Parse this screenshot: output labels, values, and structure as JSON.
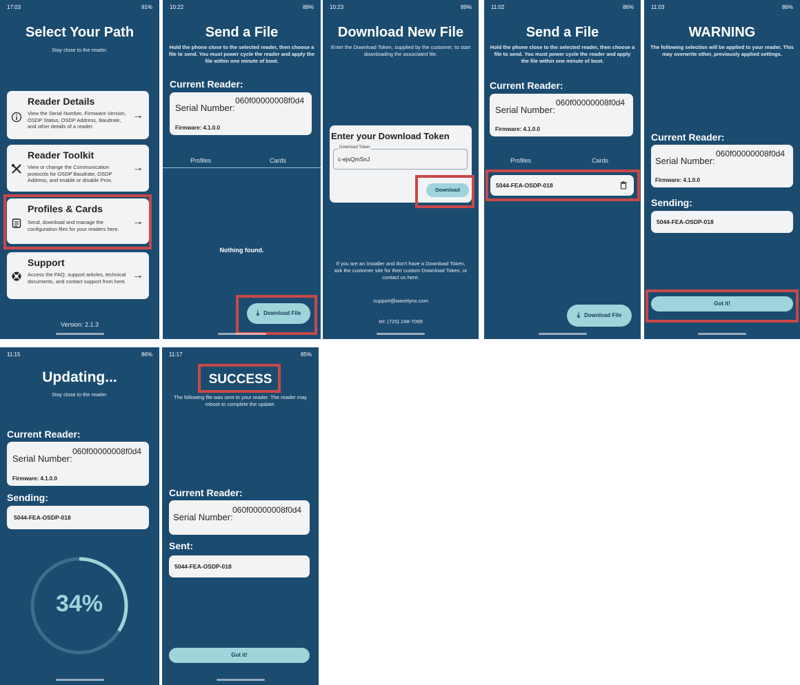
{
  "screens": {
    "s1": {
      "status_time": "17:03",
      "status_right": "91%",
      "title": "Select Your Path",
      "subtitle": "Stay close to the reader.",
      "items": [
        {
          "title": "Reader Details",
          "desc": "View the Serial Number, Firmware Version, OSDP Status, OSDP Address, Baudrate, and other details of a reader.",
          "icon": "info-icon"
        },
        {
          "title": "Reader Toolkit",
          "desc": "View or change the Communication protocols for OSDP Baudrate, OSDP Address, and enable or disable Prox.",
          "icon": "tools-icon"
        },
        {
          "title": "Profiles & Cards",
          "desc": "Send, download and manage the configuration files for your readers here.",
          "icon": "document-icon"
        },
        {
          "title": "Support",
          "desc": "Access the FAQ, support articles, technical documents, and contact support from here.",
          "icon": "lifebuoy-icon"
        }
      ],
      "arrow": "→",
      "version": "Version: 2.1.3"
    },
    "s2": {
      "status_time": "10:22",
      "status_right": "89%",
      "title": "Send a File",
      "subtitle": "Hold the phone close to the selected reader, then choose a file to send. You must power cycle the reader and apply the file within one minute of boot.",
      "current_reader_label": "Current Reader:",
      "serial_label": "Serial Number:",
      "serial_value": "060f00000008f0d4",
      "firmware": "Firmware: 4.1.0.0",
      "tab_profiles": "Profiles",
      "tab_cards": "Cards",
      "empty": "Nothing found.",
      "download_button": "Download File"
    },
    "s3": {
      "status_time": "10:23",
      "status_right": "89%",
      "title": "Download New File",
      "subtitle": "Enter the Download Token, supplied by the customer, to start downloading the associated file.",
      "card_title": "Enter your Download Token",
      "field_label": "Download Token",
      "field_value": "c-ejsQmSnJ",
      "download_button": "Download",
      "help": "If you are an Installer and don't have a Download Token, ask the customer site for their custom Download Token, or contact us here:",
      "email": "support@wavelynx.com",
      "tel": "tel: (720) 248-7069"
    },
    "s4": {
      "status_time": "11:02",
      "status_right": "86%",
      "title": "Send a File",
      "subtitle": "Hold the phone close to the selected reader, then choose a file to send. You must power cycle the reader and apply the file within one minute of boot.",
      "current_reader_label": "Current Reader:",
      "serial_label": "Serial Number:",
      "serial_value": "060f00000008f0d4",
      "firmware": "Firmware: 4.1.0.0",
      "tab_profiles": "Profiles",
      "tab_cards": "Cards",
      "file": "5044-FEA-OSDP-018",
      "download_button": "Download File"
    },
    "s5": {
      "status_time": "11:03",
      "status_right": "86%",
      "title": "WARNING",
      "subtitle": "The following selection will be applied to your reader. This may overwrite other, previously applied settings.",
      "current_reader_label": "Current Reader:",
      "serial_label": "Serial Number:",
      "serial_value": "060f00000008f0d4",
      "firmware": "Firmware: 4.1.0.0",
      "sending_label": "Sending:",
      "file": "5044-FEA-OSDP-018",
      "button": "Got it!"
    },
    "s6": {
      "status_time": "11:15",
      "status_right": "86%",
      "title": "Updating...",
      "subtitle": "Stay close to the reader.",
      "current_reader_label": "Current Reader:",
      "serial_label": "Serial Number:",
      "serial_value": "060f00000008f0d4",
      "firmware": "Firmware: 4.1.0.0",
      "sending_label": "Sending:",
      "file": "5044-FEA-OSDP-018",
      "progress": "34%",
      "progress_value": 0.34
    },
    "s7": {
      "status_time": "11:17",
      "status_right": "85%",
      "title": "SUCCESS",
      "subtitle": "The following file was sent to your reader. The reader may reboot to complete the update.",
      "current_reader_label": "Current Reader:",
      "serial_label": "Serial Number:",
      "serial_value": "060f00000008f0d4",
      "sent_label": "Sent:",
      "file": "5044-FEA-OSDP-018",
      "button": "Got it!"
    }
  },
  "colors": {
    "background": "#1c4b70",
    "card": "#f2f3f5",
    "accent": "#9fd4da",
    "highlight": "#c94848"
  }
}
